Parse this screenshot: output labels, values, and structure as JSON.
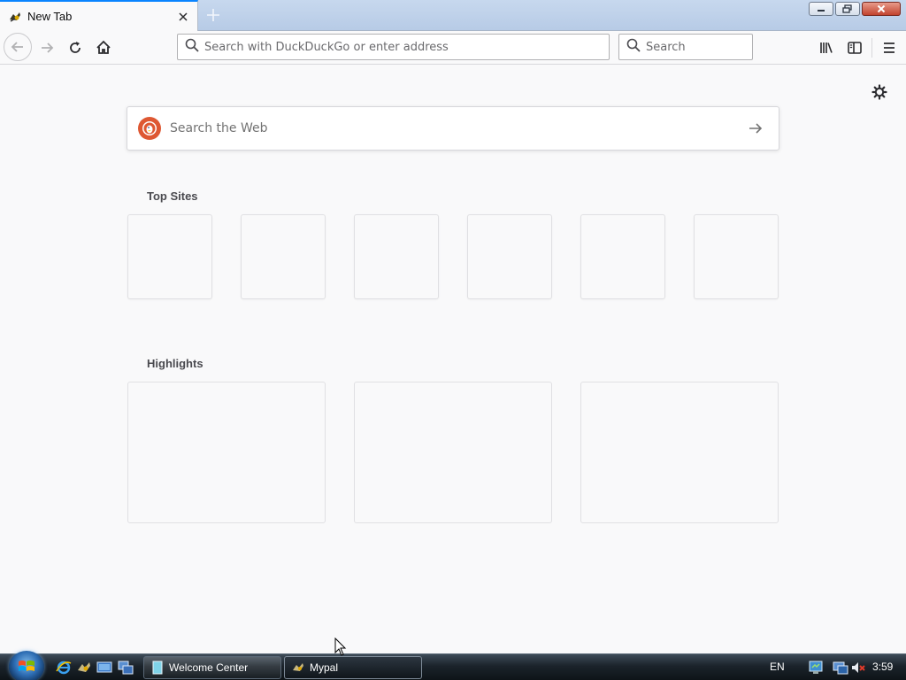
{
  "tab": {
    "title": "New Tab",
    "favicon": "mypal-icon"
  },
  "window_controls": [
    "minimize",
    "restore",
    "close"
  ],
  "nav": {
    "url_placeholder": "Search with DuckDuckGo or enter address",
    "search_placeholder": "Search"
  },
  "content": {
    "web_search_placeholder": "Search the Web",
    "top_sites_title": "Top Sites",
    "top_sites_count": 6,
    "highlights_title": "Highlights",
    "highlights_count": 3
  },
  "taskbar": {
    "buttons": [
      {
        "label": "Welcome Center",
        "active": false
      },
      {
        "label": "Mypal",
        "active": true
      }
    ],
    "language": "EN",
    "clock": "3:59"
  },
  "colors": {
    "accent": "#0a84ff",
    "ddg": "#de5833",
    "background": "#f9f9fa"
  }
}
